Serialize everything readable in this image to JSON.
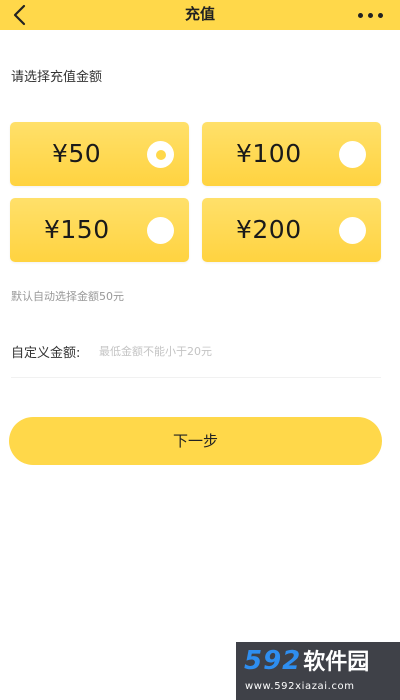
{
  "header": {
    "title": "充值",
    "back_icon": "chevron-left-icon",
    "more_icon": "more-dots-icon"
  },
  "amount_section": {
    "label": "请选择充值金额",
    "options": [
      {
        "amount": "¥50",
        "selected": true
      },
      {
        "amount": "¥100",
        "selected": false
      },
      {
        "amount": "¥150",
        "selected": false
      },
      {
        "amount": "¥200",
        "selected": false
      }
    ],
    "default_hint": "默认自动选择金额50元"
  },
  "custom_amount": {
    "label": "自定义金额:",
    "placeholder": "最低金额不能小于20元",
    "value": ""
  },
  "next_button": {
    "label": "下一步"
  },
  "watermark": {
    "number": "592",
    "name": "软件园",
    "url": "www.592xiazai.com"
  },
  "colors": {
    "accent": "#FFD84A",
    "card_top": "#FFE06A",
    "card_bottom": "#FFD340",
    "hint_text": "#999999",
    "placeholder_text": "#C4C4C4",
    "watermark_bg": "#3F4148",
    "watermark_number": "#2E8EF0"
  }
}
